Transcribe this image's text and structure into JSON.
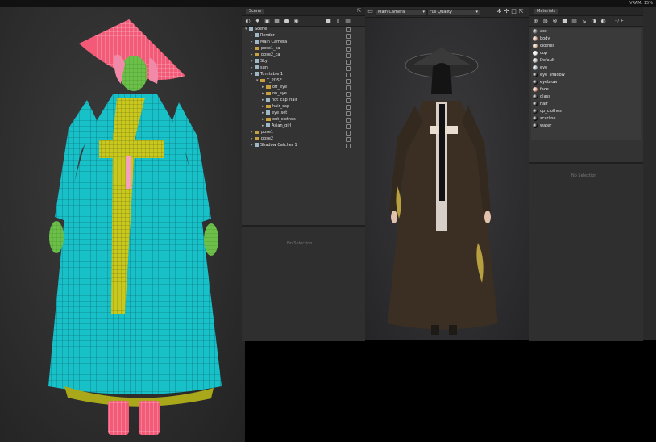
{
  "status": {
    "vram": "VRAM: 15%"
  },
  "scene_panel": {
    "tab": "Scene",
    "no_selection": "No Selection",
    "items": [
      {
        "label": "Scene",
        "icon": "scene-icon",
        "depth": 0,
        "open": true
      },
      {
        "label": "Render",
        "icon": "render-icon",
        "depth": 1,
        "open": false
      },
      {
        "label": "Main Camera",
        "icon": "camera-icon",
        "depth": 1,
        "open": false
      },
      {
        "label": "pose1_ca",
        "icon": "folder-icon",
        "depth": 1,
        "open": false
      },
      {
        "label": "pose2_ca",
        "icon": "folder-icon",
        "depth": 1,
        "open": false
      },
      {
        "label": "Sky",
        "icon": "sky-icon",
        "depth": 1,
        "open": false
      },
      {
        "label": "sun",
        "icon": "sun-icon",
        "depth": 1,
        "open": false
      },
      {
        "label": "Turntable 1",
        "icon": "turntable-icon",
        "depth": 1,
        "open": true
      },
      {
        "label": "T_POSE",
        "icon": "folder-icon",
        "depth": 2,
        "open": true
      },
      {
        "label": "off_eye",
        "icon": "folder-icon",
        "depth": 3,
        "open": false
      },
      {
        "label": "on_eye",
        "icon": "folder-icon",
        "depth": 3,
        "open": false
      },
      {
        "label": "not_cap_hair",
        "icon": "mesh-icon",
        "depth": 3,
        "open": false
      },
      {
        "label": "hair_cap",
        "icon": "folder-icon",
        "depth": 3,
        "open": false
      },
      {
        "label": "eye_set",
        "icon": "mesh-icon",
        "depth": 3,
        "open": false
      },
      {
        "label": "out_clothes",
        "icon": "folder-icon",
        "depth": 3,
        "open": false
      },
      {
        "label": "Asian_girl",
        "icon": "mesh-icon",
        "depth": 3,
        "open": false
      },
      {
        "label": "pose1",
        "icon": "folder-icon",
        "depth": 1,
        "open": false
      },
      {
        "label": "pose2",
        "icon": "folder-icon",
        "depth": 1,
        "open": false
      },
      {
        "label": "Shadow Catcher 1",
        "icon": "shadow-icon",
        "depth": 1,
        "open": false
      }
    ]
  },
  "render_panel": {
    "camera": "Main Camera",
    "quality": "Full Quality"
  },
  "materials_panel": {
    "tab": "Materials",
    "zoom_label": "- / +",
    "no_selection": "No Selection",
    "items": [
      {
        "label": "acc",
        "color": "#6a6a6a"
      },
      {
        "label": "body",
        "color": "#c89a84"
      },
      {
        "label": "clothes",
        "color": "#d9b59a"
      },
      {
        "label": "cup",
        "color": "#e8e8e8"
      },
      {
        "label": "Default",
        "color": "#bcbcbc"
      },
      {
        "label": "eye",
        "color": "#a0a8b0"
      },
      {
        "label": "eye_shadow",
        "color": "#111111"
      },
      {
        "label": "eyebrow",
        "color": "#1a1a1a"
      },
      {
        "label": "face",
        "color": "#d49a82"
      },
      {
        "label": "glass",
        "color": "#222222"
      },
      {
        "label": "hair",
        "color": "#141414"
      },
      {
        "label": "op_clothes",
        "color": "#1c1c1c"
      },
      {
        "label": "scarline",
        "color": "#151515"
      },
      {
        "label": "water",
        "color": "#0f0f0f"
      }
    ]
  }
}
